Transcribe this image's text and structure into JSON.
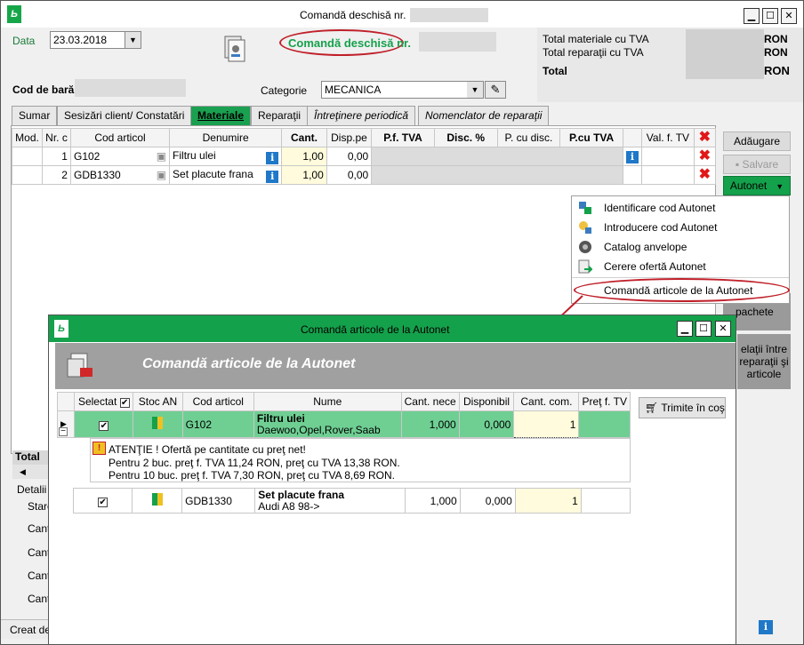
{
  "window": {
    "title": "Comandă deschisă nr.",
    "controls": {
      "minimize": "▁",
      "maximize": "☐",
      "close": "✕"
    }
  },
  "header": {
    "date_label": "Data",
    "date_value": "23.03.2018",
    "heading": "Comandă deschisă nr.",
    "totals": {
      "materials_label": "Total materiale cu TVA",
      "materials_currency": "RON",
      "repairs_label": "Total reparaţii cu TVA",
      "repairs_currency": "RON",
      "total_label": "Total",
      "total_currency": "RON"
    },
    "barcode_label": "Cod de bară:",
    "category_label": "Categorie",
    "category_value": "MECANICA"
  },
  "tabs": [
    {
      "label": "Sumar"
    },
    {
      "label": "Sesizări client/ Constatări"
    },
    {
      "label": "Materiale"
    },
    {
      "label": "Reparaţii"
    },
    {
      "label": "Întreţinere periodică"
    },
    {
      "label": "Nomenclator de reparaţii"
    }
  ],
  "materials_table": {
    "columns": [
      "Mod.",
      "Nr. c",
      "Cod articol",
      "Denumire",
      "Cant.",
      "Disp.pe",
      "P.f. TVA",
      "Disc. %",
      "P. cu disc.",
      "P.cu TVA",
      "Val. f. TV"
    ],
    "rows": [
      {
        "nr": "1",
        "code": "G102",
        "name": "Filtru ulei",
        "qty": "1,00",
        "disp": "0,00"
      },
      {
        "nr": "2",
        "code": "GDB1330",
        "name": "Set placute frana",
        "qty": "1,00",
        "disp": "0,00"
      }
    ]
  },
  "side_buttons": {
    "add": "Adăugare",
    "save": "Salvare",
    "autonet": "Autonet",
    "packages": "pachete",
    "relations": "elaţii între reparaţii şi articole"
  },
  "autonet_menu": [
    {
      "label": "Identificare cod Autonet",
      "icon": "identify-icon"
    },
    {
      "label": "Introducere cod Autonet",
      "icon": "key-in-icon"
    },
    {
      "label": "Catalog anvelope",
      "icon": "tire-icon"
    },
    {
      "label": "Cerere ofertă Autonet",
      "icon": "offer-request-icon"
    },
    {
      "label": "Comandă articole de la Autonet",
      "icon": ""
    }
  ],
  "bottom_left": {
    "total_label": "Total",
    "details_label": "Detalii",
    "stare_label": "Stare",
    "cant_labels": [
      "Cant",
      "Cant",
      "Cant",
      "Cant"
    ],
    "created_label": "Creat de"
  },
  "dialog": {
    "title": "Comandă articole de la Autonet",
    "heading": "Comandă articole de la Autonet",
    "send_button": "Trimite în coş",
    "columns": [
      "Selectat",
      "Stoc AN",
      "Cod articol",
      "Nume",
      "Cant. nece",
      "Disponibil",
      "Cant. com.",
      "Preţ f. TV"
    ],
    "rows": [
      {
        "code": "G102",
        "name": "Filtru ulei",
        "sub": "Daewoo,Opel,Rover,Saab",
        "need": "1,000",
        "avail": "0,000",
        "order": "1"
      },
      {
        "code": "GDB1330",
        "name": "Set placute frana",
        "sub": "Audi A8 98->",
        "need": "1,000",
        "avail": "0,000",
        "order": "1"
      }
    ],
    "warning": {
      "title": "ATENŢIE ! Ofertă pe cantitate cu preţ net!",
      "line1": "Pentru 2 buc. preţ f. TVA 11,24 RON, preţ cu TVA 13,38 RON.",
      "line2": "Pentru 10 buc. preţ f. TVA 7,30 RON, preţ cu TVA 8,69 RON."
    }
  },
  "colors": {
    "green": "#14a14b",
    "highlight_row": "#6fcf93",
    "annotation": "#c0202a",
    "qty_bg": "#fffbdc"
  }
}
